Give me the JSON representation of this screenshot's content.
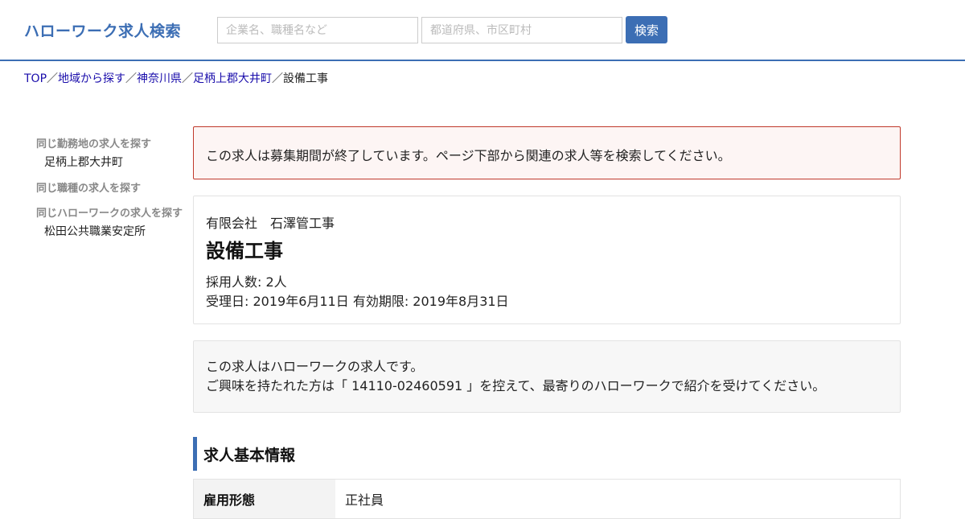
{
  "header": {
    "logo": "ハローワーク求人検索",
    "keyword_placeholder": "企業名、職種名など",
    "area_placeholder": "都道府県、市区町村",
    "search_label": "検索"
  },
  "breadcrumb": {
    "top": "TOP",
    "region": "地域から探す",
    "prefecture": "神奈川県",
    "town": "足柄上郡大井町",
    "current": "設備工事",
    "sep": "／"
  },
  "sidebar": {
    "same_location_heading": "同じ勤務地の求人を探す",
    "same_location_item": "足柄上郡大井町",
    "same_job_heading": "同じ職種の求人を探す",
    "same_office_heading": "同じハローワークの求人を探す",
    "same_office_item": "松田公共職業安定所"
  },
  "notice": "この求人は募集期間が終了しています。ページ下部から関連の求人等を検索してください。",
  "job": {
    "company": "有限会社　石澤管工事",
    "title": "設備工事",
    "headcount": "採用人数: 2人",
    "dates": "受理日: 2019年6月11日 有効期限: 2019年8月31日"
  },
  "info": {
    "line1": "この求人はハローワークの求人です。",
    "line2": "ご興味を持たれた方は「 14110-02460591 」を控えて、最寄りのハローワークで紹介を受けてください。"
  },
  "basic_info": {
    "title": "求人基本情報",
    "rows": [
      {
        "label": "雇用形態",
        "value": "正社員"
      }
    ]
  }
}
